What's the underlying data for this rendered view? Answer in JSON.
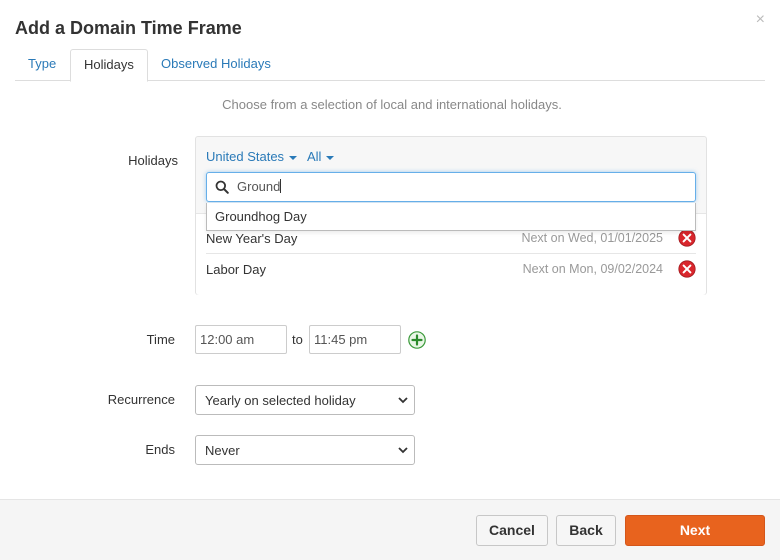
{
  "dialog": {
    "title": "Add a Domain Time Frame",
    "close_glyph": "×"
  },
  "tabs": [
    {
      "label": "Type",
      "active": false
    },
    {
      "label": "Holidays",
      "active": true
    },
    {
      "label": "Observed Holidays",
      "active": false
    }
  ],
  "intro_text": "Choose from a selection of local and international holidays.",
  "holidays": {
    "label": "Holidays",
    "country_filter": "United States",
    "type_filter": "All",
    "search_value": "Ground",
    "suggestions": [
      "Groundhog Day"
    ],
    "selected": [
      {
        "name": "New Year's Day",
        "next": "Next on Wed, 01/01/2025"
      },
      {
        "name": "Labor Day",
        "next": "Next on Mon, 09/02/2024"
      }
    ]
  },
  "time": {
    "label": "Time",
    "from": "12:00 am",
    "separator": "to",
    "to": "11:45 pm"
  },
  "recurrence": {
    "label": "Recurrence",
    "value": "Yearly on selected holiday"
  },
  "ends": {
    "label": "Ends",
    "value": "Never"
  },
  "footer": {
    "cancel_label": "Cancel",
    "back_label": "Back",
    "next_label": "Next"
  },
  "colors": {
    "accent": "#e8631e",
    "link": "#2a7ab8",
    "remove": "#d9262c",
    "add": "#3a9a3a"
  }
}
